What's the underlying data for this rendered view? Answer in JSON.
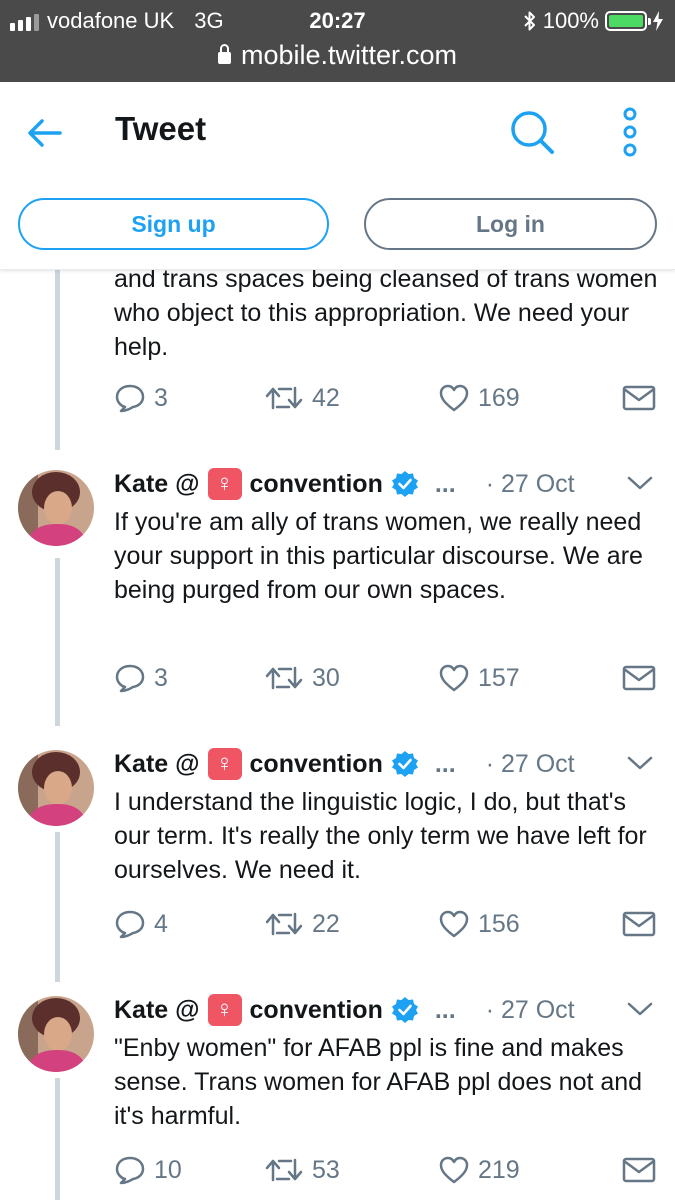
{
  "status_bar": {
    "carrier": "vodafone UK",
    "network": "3G",
    "time": "20:27",
    "battery": "100%",
    "url": "mobile.twitter.com"
  },
  "header": {
    "title": "Tweet"
  },
  "auth": {
    "signup_label": "Sign up",
    "login_label": "Log in"
  },
  "partial_tweet": {
    "text": "and trans spaces being cleansed of trans women who object to this appropriation. We need your help.",
    "replies": "3",
    "retweets": "42",
    "likes": "169"
  },
  "tweets": [
    {
      "name_prefix": "Kate @",
      "name_suffix": "convention",
      "ellipsis": "...",
      "date": "· 27 Oct",
      "text": "If you're am ally of trans women, we really need your support in this particular discourse. We are being purged from our own spaces.",
      "replies": "3",
      "retweets": "30",
      "likes": "157"
    },
    {
      "name_prefix": "Kate @",
      "name_suffix": "convention",
      "ellipsis": "...",
      "date": "· 27 Oct",
      "text": "I understand the linguistic logic, I do, but that's our term. It's really the only term we have left for ourselves. We need it.",
      "replies": "4",
      "retweets": "22",
      "likes": "156"
    },
    {
      "name_prefix": "Kate @",
      "name_suffix": "convention",
      "ellipsis": "...",
      "date": "· 27 Oct",
      "text": "\"Enby women\" for AFAB ppl is fine and makes sense. Trans women for AFAB ppl does not and it's harmful.",
      "replies": "10",
      "retweets": "53",
      "likes": "219"
    }
  ],
  "colors": {
    "accent": "#1da1f2",
    "muted": "#657786",
    "text": "#14171a",
    "thread_line": "#ccd6dd",
    "status_bar": "#4a4a4a",
    "battery": "#4cd964",
    "venus_badge": "#ef5563"
  },
  "icons": [
    "signal-icon",
    "lock-icon",
    "bluetooth-icon",
    "battery-icon",
    "back-arrow-icon",
    "search-icon",
    "more-icon",
    "venus-icon",
    "verified-icon",
    "chevron-down-icon",
    "reply-icon",
    "retweet-icon",
    "like-icon",
    "message-icon"
  ]
}
